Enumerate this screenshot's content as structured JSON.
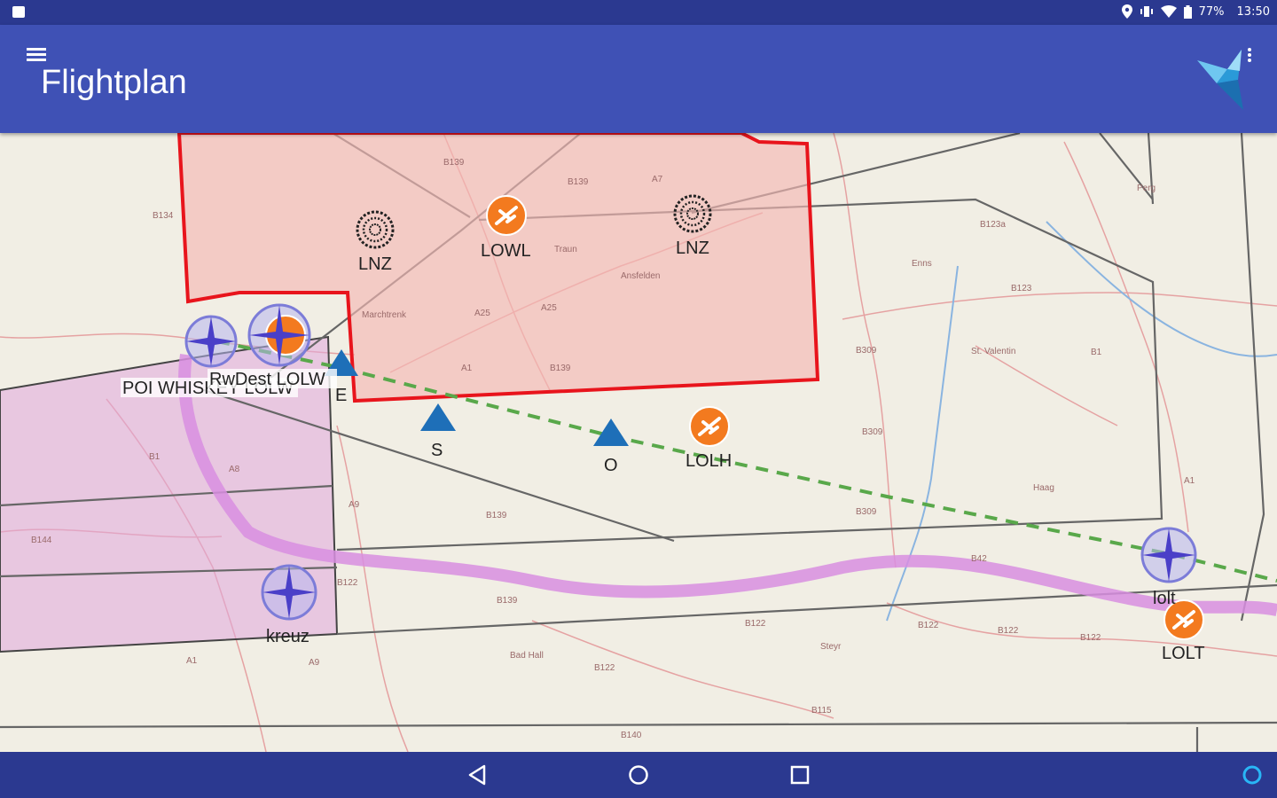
{
  "status_bar": {
    "battery": "77%",
    "time": "13:50"
  },
  "app_bar": {
    "title": "Flightplan"
  },
  "map": {
    "waypoints": [
      {
        "name": "LOWL",
        "type": "airport"
      },
      {
        "name": "LNZ",
        "type": "vor"
      },
      {
        "name": "LNZ",
        "type": "vor"
      },
      {
        "name": "LOLH",
        "type": "airport"
      },
      {
        "name": "LOLT",
        "type": "airport"
      },
      {
        "name": "lolt",
        "type": "reporting-point"
      },
      {
        "name": "kreuz",
        "type": "reporting-point"
      },
      {
        "name": "S",
        "type": "triangle"
      },
      {
        "name": "O",
        "type": "triangle"
      },
      {
        "name": "E",
        "type": "triangle"
      },
      {
        "name": "POI WHISKEY LOLW",
        "type": "poi"
      },
      {
        "name": "RwDest LOLW",
        "type": "destination"
      }
    ],
    "place_labels": [
      "B139",
      "B139",
      "B134",
      "A7",
      "Traun",
      "Ansfelden",
      "Marchtrenk",
      "A25",
      "A25",
      "A1",
      "B139",
      "Enns",
      "Perg",
      "B123",
      "B123a",
      "St. Valentin",
      "B1",
      "A1",
      "B309",
      "B309",
      "B309",
      "Haag",
      "B122",
      "B122",
      "B122",
      "B122",
      "Steyr",
      "Bad Hall",
      "B115",
      "B140",
      "A9",
      "A8",
      "B1",
      "B144",
      "A1",
      "B139",
      "B139",
      "B122",
      "A9",
      "B122",
      "B42"
    ],
    "colors": {
      "ctr_border": "#e8141c",
      "ctr_fill": "#f5b8b3",
      "tma_fill": "#e0a8dc",
      "route": "#59a84a",
      "airway": "#d88ee0",
      "airport": "#f37a1f"
    }
  },
  "nav_bar": {
    "back": "back-icon",
    "home": "home-icon",
    "recents": "recents-icon"
  }
}
